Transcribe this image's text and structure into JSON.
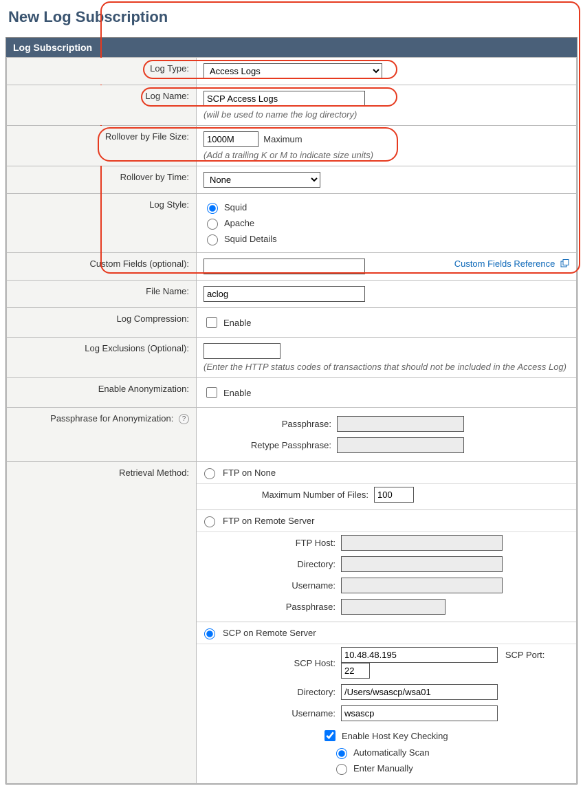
{
  "page_title": "New Log Subscription",
  "panel_title": "Log Subscription",
  "labels": {
    "log_type": "Log Type:",
    "log_name": "Log Name:",
    "log_name_help": "(will be used to name the log directory)",
    "rollover_size": "Rollover by File Size:",
    "rollover_size_suffix": "Maximum",
    "rollover_size_help": "(Add a trailing K or M to indicate size units)",
    "rollover_time": "Rollover by Time:",
    "log_style": "Log Style:",
    "custom_fields": "Custom Fields (optional):",
    "custom_fields_link": "Custom Fields Reference",
    "file_name": "File Name:",
    "log_compression": "Log Compression:",
    "enable": "Enable",
    "log_exclusions": "Log Exclusions (Optional):",
    "log_exclusions_help": "(Enter the HTTP status codes of transactions that should not be included in the Access Log)",
    "enable_anon": "Enable Anonymization:",
    "passphrase_anon": "Passphrase for Anonymization:",
    "passphrase": "Passphrase:",
    "retype_passphrase": "Retype Passphrase:",
    "retrieval_method": "Retrieval Method:",
    "ftp_none": "FTP on None",
    "max_files": "Maximum Number of Files:",
    "ftp_remote": "FTP on Remote Server",
    "ftp_host": "FTP Host:",
    "directory": "Directory:",
    "username": "Username:",
    "scp_remote": "SCP on Remote Server",
    "scp_host": "SCP Host:",
    "scp_port": "SCP Port:",
    "enable_host_key": "Enable Host Key Checking",
    "auto_scan": "Automatically Scan",
    "enter_manually": "Enter Manually"
  },
  "values": {
    "log_type": "Access Logs",
    "log_name": "SCP Access Logs",
    "rollover_size": "1000M",
    "rollover_time": "None",
    "custom_fields": "",
    "file_name": "aclog",
    "log_exclusions": "",
    "max_files": "100",
    "ftp_host": "",
    "ftp_directory": "",
    "ftp_username": "",
    "ftp_passphrase": "",
    "scp_host": "10.48.48.195",
    "scp_port": "22",
    "scp_directory": "/Users/wsascp/wsa01",
    "scp_username": "wsascp"
  },
  "log_style_options": {
    "squid": "Squid",
    "apache": "Apache",
    "squid_details": "Squid Details"
  }
}
